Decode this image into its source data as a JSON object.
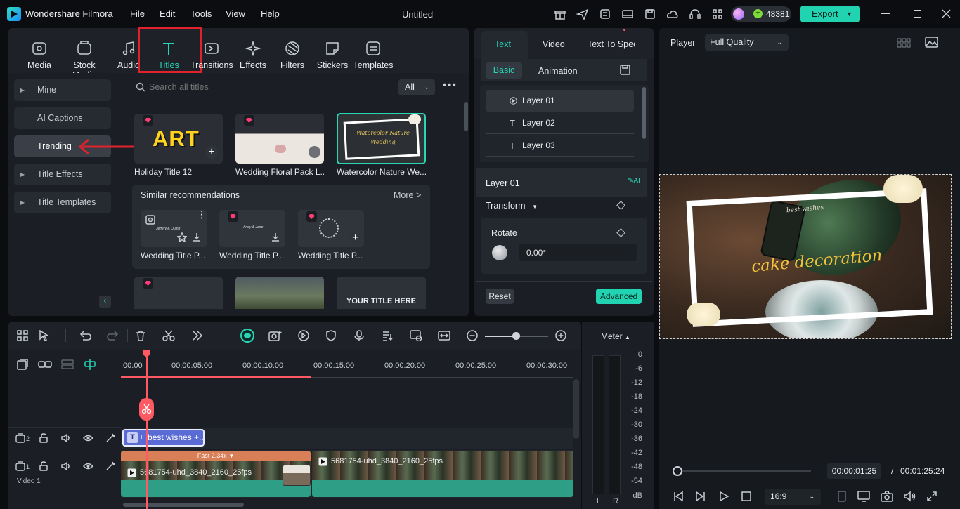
{
  "app": {
    "name": "Wondershare Filmora",
    "title": "Untitled",
    "credits": "48381",
    "export": "Export",
    "menu": [
      "File",
      "Edit",
      "Tools",
      "View",
      "Help"
    ]
  },
  "toolbar": [
    "Media",
    "Stock Media",
    "Audio",
    "Titles",
    "Transitions",
    "Effects",
    "Filters",
    "Stickers",
    "Templates"
  ],
  "sidebar": {
    "items": [
      "Mine",
      "AI Captions",
      "Trending",
      "Title Effects",
      "Title Templates"
    ]
  },
  "search": {
    "placeholder": "Search all titles",
    "filter": "All"
  },
  "titles": [
    "Holiday Title 12",
    "Wedding Floral Pack L...",
    "Watercolor Nature We..."
  ],
  "thumb_text": {
    "art": "ART",
    "watercolor": "Watercolor Nature Wedding",
    "your_title": "YOUR TITLE HERE",
    "andy_jane": "Andy & Jane",
    "jeffery_quinn": "Jeffery & Quinn"
  },
  "similar": {
    "header": "Similar recommendations",
    "more": "More >",
    "items": [
      "Wedding Title P...",
      "Wedding Title P...",
      "Wedding Title P..."
    ]
  },
  "props": {
    "tabs": [
      "Text",
      "Video",
      "Text To Speech"
    ],
    "subtabs": [
      "Basic",
      "Animation"
    ],
    "layers": [
      "Layer 01",
      "Layer 02",
      "Layer 03"
    ],
    "selected_layer": "Layer 01",
    "ai": "AI",
    "transform": "Transform",
    "rotate": "Rotate",
    "rotate_value": "0.00°",
    "reset": "Reset",
    "advanced": "Advanced"
  },
  "player": {
    "label": "Player",
    "quality": "Full Quality",
    "overlay": "cake decoration",
    "overlay_small": "best wishes",
    "current": "00:00:01:25",
    "separator": "/",
    "total": "00:01:25:24",
    "ratio": "16:9",
    "progress": 0.02
  },
  "timeline": {
    "ticks": [
      ":00:00",
      "00:00:05:00",
      "00:00:10:00",
      "00:00:15:00",
      "00:00:20:00",
      "00:00:25:00",
      "00:00:30:00"
    ],
    "track2_num": "2",
    "track1_num": "1",
    "track1_name": "Video 1",
    "title_clip": "best wishes +...",
    "speed": "Fast 2.34x",
    "clip1": "5681754-uhd_3840_2160_25fps",
    "clip2": "5681754-uhd_3840_2160_25fps"
  },
  "meter": {
    "label": "Meter",
    "scale": [
      "0",
      "-6",
      "-12",
      "-18",
      "-24",
      "-30",
      "-36",
      "-42",
      "-48",
      "-54",
      "dB"
    ],
    "left": "L",
    "right": "R"
  },
  "colors": {
    "accent": "#27d6b7",
    "highlight": "#e0222c",
    "playhead": "#ff5a63"
  }
}
